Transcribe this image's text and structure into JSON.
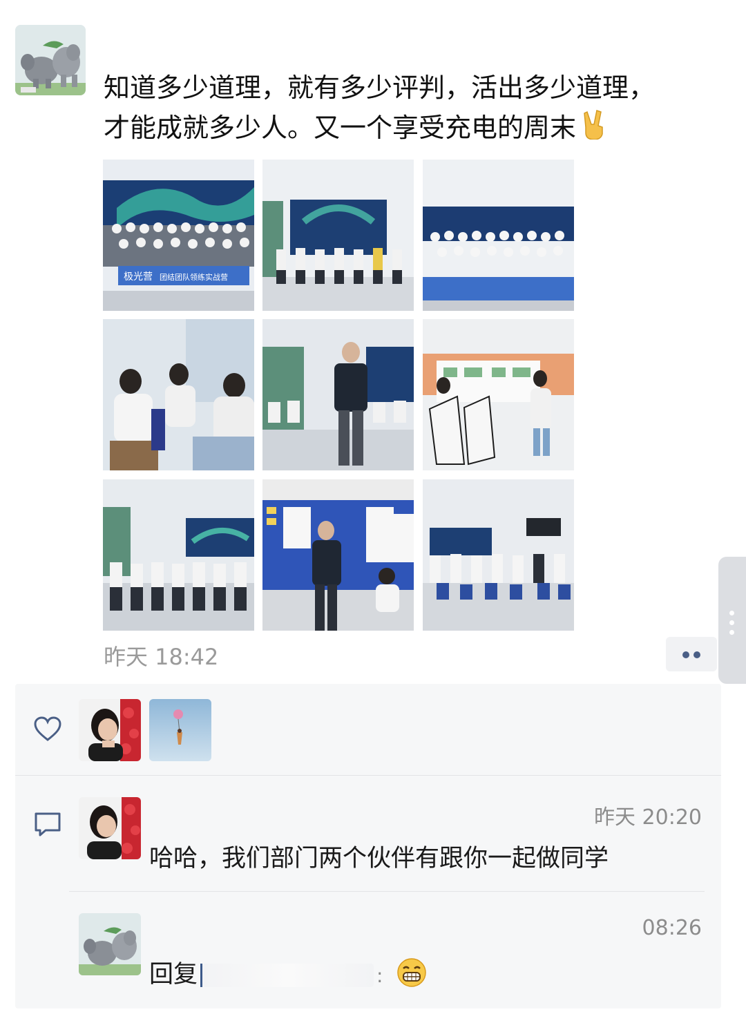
{
  "post": {
    "text_line1": "知道多少道理，就有多少评判，活出多少道理，",
    "text_line2": "才能成就多少人。又一个享受充电的周末",
    "emoji": "victory-hand",
    "timestamp": "昨天 18:42",
    "photo_count": 9,
    "banner_text_1": "极光营",
    "banner_text_2": "团结团队领练实战营"
  },
  "likes": {
    "icon": "heart-icon",
    "likers": [
      "liker-1",
      "liker-2"
    ]
  },
  "comments": [
    {
      "time": "昨天 20:20",
      "text": "哈哈，我们部门两个伙伴有跟你一起做同学"
    },
    {
      "time": "08:26",
      "reply_prefix": "回复",
      "emoji": "grinning-face"
    }
  ],
  "colors": {
    "page_bg": "#ffffff",
    "panel_bg": "#f6f7f8",
    "link_blue": "#4a5f86",
    "muted_text": "#9a9a9a"
  }
}
